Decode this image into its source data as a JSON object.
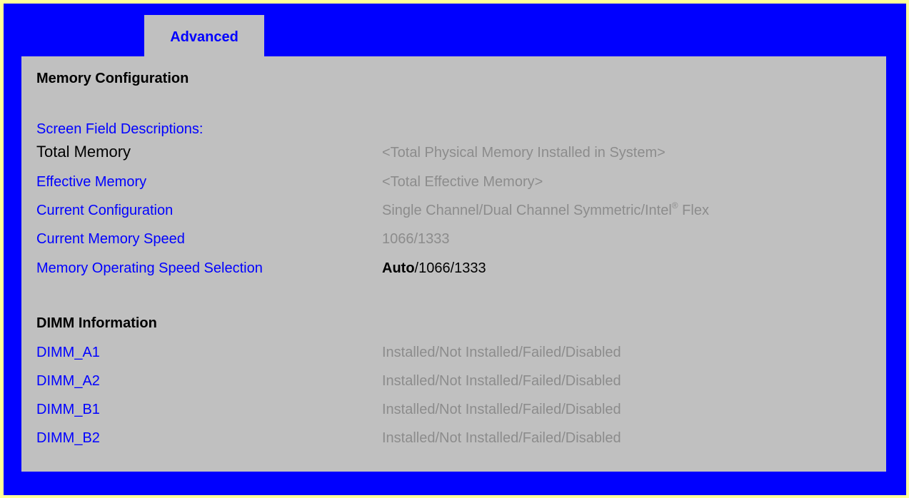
{
  "tabs": [
    {
      "label": "Advanced"
    }
  ],
  "section": {
    "title": "Memory Configuration",
    "descriptions_label": "Screen Field Descriptions:"
  },
  "fields": [
    {
      "label": "Total Memory",
      "value": "<Total Physical Memory Installed in System>"
    },
    {
      "label": "Effective Memory",
      "value": "<Total Effective Memory>"
    },
    {
      "label": "Current Configuration",
      "value": "Single Channel/Dual Channel Symmetric/Intel",
      "value_sup": "®",
      "value_suffix": " Flex"
    },
    {
      "label": "Current Memory Speed",
      "value": "1066/1333"
    },
    {
      "label": "Memory Operating Speed Selection",
      "value_bold": "Auto",
      "value": "/1066/1333"
    }
  ],
  "dimm": {
    "title": "DIMM Information",
    "items": [
      {
        "label": "DIMM_A1",
        "value": "Installed/Not Installed/Failed/Disabled"
      },
      {
        "label": "DIMM_A2",
        "value": "Installed/Not Installed/Failed/Disabled"
      },
      {
        "label": "DIMM_B1",
        "value": "Installed/Not Installed/Failed/Disabled"
      },
      {
        "label": "DIMM_B2",
        "value": "Installed/Not Installed/Failed/Disabled"
      }
    ]
  },
  "colors": {
    "outer_border": "#ffff99",
    "background": "#0000ff",
    "panel": "#c0c0c0",
    "label_blue": "#0000ff",
    "value_gray": "#8c8c8c"
  }
}
